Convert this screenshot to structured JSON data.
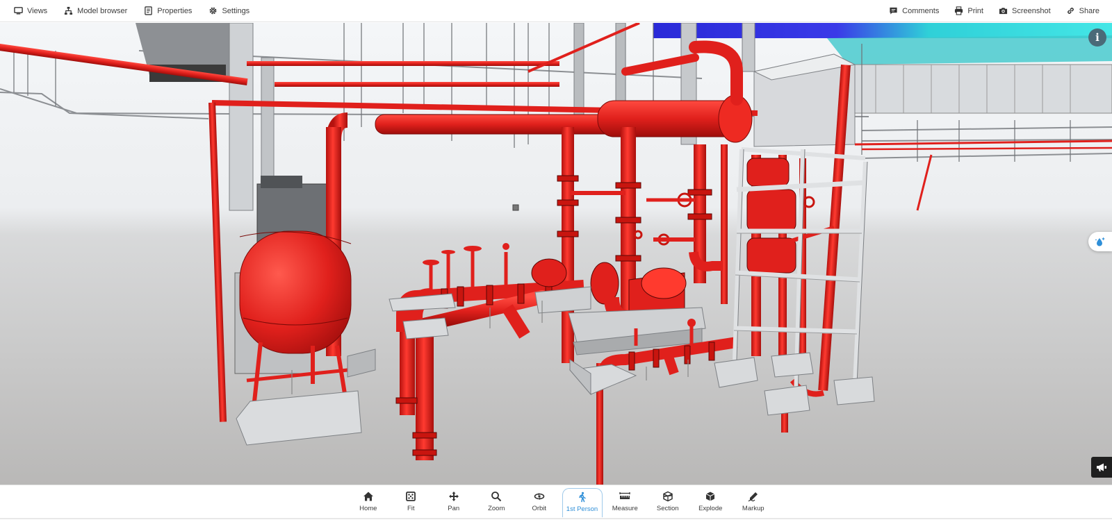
{
  "topbar": {
    "left": [
      {
        "label": "Views",
        "icon": "monitor-icon"
      },
      {
        "label": "Model browser",
        "icon": "hierarchy-icon"
      },
      {
        "label": "Properties",
        "icon": "document-icon"
      },
      {
        "label": "Settings",
        "icon": "gear-icon"
      }
    ],
    "right": [
      {
        "label": "Comments",
        "icon": "comment-icon"
      },
      {
        "label": "Print",
        "icon": "printer-icon"
      },
      {
        "label": "Screenshot",
        "icon": "camera-icon"
      },
      {
        "label": "Share",
        "icon": "link-icon"
      }
    ]
  },
  "viewport": {
    "info_label": "i",
    "scene_description_icon": "3d-model-canvas"
  },
  "toolbar": {
    "active_tool": "1st Person",
    "tools": [
      {
        "label": "Home",
        "icon": "home-icon"
      },
      {
        "label": "Fit",
        "icon": "fit-icon"
      },
      {
        "label": "Pan",
        "icon": "pan-icon"
      },
      {
        "label": "Zoom",
        "icon": "zoom-icon"
      },
      {
        "label": "Orbit",
        "icon": "orbit-icon"
      },
      {
        "label": "1st Person",
        "icon": "walk-icon"
      },
      {
        "label": "Measure",
        "icon": "ruler-icon"
      },
      {
        "label": "Section",
        "icon": "section-icon"
      },
      {
        "label": "Explode",
        "icon": "explode-icon"
      },
      {
        "label": "Markup",
        "icon": "pen-icon"
      }
    ]
  },
  "colors": {
    "pipe_red": "#e0201c",
    "steel_gray": "#c9ccd0",
    "active_blue": "#2f8fd8",
    "info_button": "#4a6a78"
  }
}
